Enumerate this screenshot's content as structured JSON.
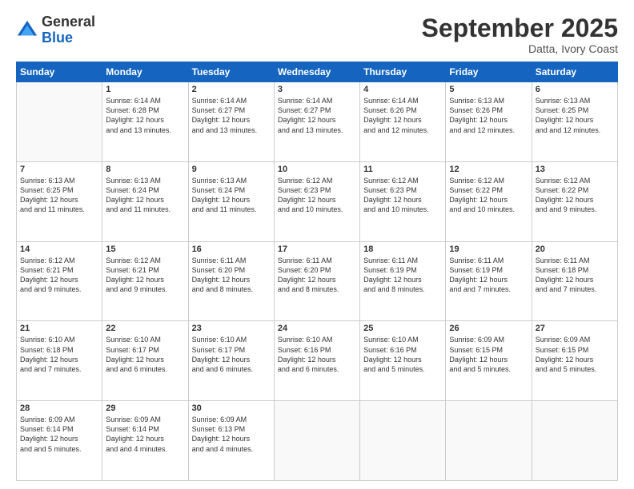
{
  "logo": {
    "general": "General",
    "blue": "Blue"
  },
  "header": {
    "month": "September 2025",
    "location": "Datta, Ivory Coast"
  },
  "weekdays": [
    "Sunday",
    "Monday",
    "Tuesday",
    "Wednesday",
    "Thursday",
    "Friday",
    "Saturday"
  ],
  "weeks": [
    [
      {
        "day": "",
        "sunrise": "",
        "sunset": "",
        "daylight": ""
      },
      {
        "day": "1",
        "sunrise": "Sunrise: 6:14 AM",
        "sunset": "Sunset: 6:28 PM",
        "daylight": "Daylight: 12 hours and 13 minutes."
      },
      {
        "day": "2",
        "sunrise": "Sunrise: 6:14 AM",
        "sunset": "Sunset: 6:27 PM",
        "daylight": "Daylight: 12 hours and 13 minutes."
      },
      {
        "day": "3",
        "sunrise": "Sunrise: 6:14 AM",
        "sunset": "Sunset: 6:27 PM",
        "daylight": "Daylight: 12 hours and 13 minutes."
      },
      {
        "day": "4",
        "sunrise": "Sunrise: 6:14 AM",
        "sunset": "Sunset: 6:26 PM",
        "daylight": "Daylight: 12 hours and 12 minutes."
      },
      {
        "day": "5",
        "sunrise": "Sunrise: 6:13 AM",
        "sunset": "Sunset: 6:26 PM",
        "daylight": "Daylight: 12 hours and 12 minutes."
      },
      {
        "day": "6",
        "sunrise": "Sunrise: 6:13 AM",
        "sunset": "Sunset: 6:25 PM",
        "daylight": "Daylight: 12 hours and 12 minutes."
      }
    ],
    [
      {
        "day": "7",
        "sunrise": "Sunrise: 6:13 AM",
        "sunset": "Sunset: 6:25 PM",
        "daylight": "Daylight: 12 hours and 11 minutes."
      },
      {
        "day": "8",
        "sunrise": "Sunrise: 6:13 AM",
        "sunset": "Sunset: 6:24 PM",
        "daylight": "Daylight: 12 hours and 11 minutes."
      },
      {
        "day": "9",
        "sunrise": "Sunrise: 6:13 AM",
        "sunset": "Sunset: 6:24 PM",
        "daylight": "Daylight: 12 hours and 11 minutes."
      },
      {
        "day": "10",
        "sunrise": "Sunrise: 6:12 AM",
        "sunset": "Sunset: 6:23 PM",
        "daylight": "Daylight: 12 hours and 10 minutes."
      },
      {
        "day": "11",
        "sunrise": "Sunrise: 6:12 AM",
        "sunset": "Sunset: 6:23 PM",
        "daylight": "Daylight: 12 hours and 10 minutes."
      },
      {
        "day": "12",
        "sunrise": "Sunrise: 6:12 AM",
        "sunset": "Sunset: 6:22 PM",
        "daylight": "Daylight: 12 hours and 10 minutes."
      },
      {
        "day": "13",
        "sunrise": "Sunrise: 6:12 AM",
        "sunset": "Sunset: 6:22 PM",
        "daylight": "Daylight: 12 hours and 9 minutes."
      }
    ],
    [
      {
        "day": "14",
        "sunrise": "Sunrise: 6:12 AM",
        "sunset": "Sunset: 6:21 PM",
        "daylight": "Daylight: 12 hours and 9 minutes."
      },
      {
        "day": "15",
        "sunrise": "Sunrise: 6:12 AM",
        "sunset": "Sunset: 6:21 PM",
        "daylight": "Daylight: 12 hours and 9 minutes."
      },
      {
        "day": "16",
        "sunrise": "Sunrise: 6:11 AM",
        "sunset": "Sunset: 6:20 PM",
        "daylight": "Daylight: 12 hours and 8 minutes."
      },
      {
        "day": "17",
        "sunrise": "Sunrise: 6:11 AM",
        "sunset": "Sunset: 6:20 PM",
        "daylight": "Daylight: 12 hours and 8 minutes."
      },
      {
        "day": "18",
        "sunrise": "Sunrise: 6:11 AM",
        "sunset": "Sunset: 6:19 PM",
        "daylight": "Daylight: 12 hours and 8 minutes."
      },
      {
        "day": "19",
        "sunrise": "Sunrise: 6:11 AM",
        "sunset": "Sunset: 6:19 PM",
        "daylight": "Daylight: 12 hours and 7 minutes."
      },
      {
        "day": "20",
        "sunrise": "Sunrise: 6:11 AM",
        "sunset": "Sunset: 6:18 PM",
        "daylight": "Daylight: 12 hours and 7 minutes."
      }
    ],
    [
      {
        "day": "21",
        "sunrise": "Sunrise: 6:10 AM",
        "sunset": "Sunset: 6:18 PM",
        "daylight": "Daylight: 12 hours and 7 minutes."
      },
      {
        "day": "22",
        "sunrise": "Sunrise: 6:10 AM",
        "sunset": "Sunset: 6:17 PM",
        "daylight": "Daylight: 12 hours and 6 minutes."
      },
      {
        "day": "23",
        "sunrise": "Sunrise: 6:10 AM",
        "sunset": "Sunset: 6:17 PM",
        "daylight": "Daylight: 12 hours and 6 minutes."
      },
      {
        "day": "24",
        "sunrise": "Sunrise: 6:10 AM",
        "sunset": "Sunset: 6:16 PM",
        "daylight": "Daylight: 12 hours and 6 minutes."
      },
      {
        "day": "25",
        "sunrise": "Sunrise: 6:10 AM",
        "sunset": "Sunset: 6:16 PM",
        "daylight": "Daylight: 12 hours and 5 minutes."
      },
      {
        "day": "26",
        "sunrise": "Sunrise: 6:09 AM",
        "sunset": "Sunset: 6:15 PM",
        "daylight": "Daylight: 12 hours and 5 minutes."
      },
      {
        "day": "27",
        "sunrise": "Sunrise: 6:09 AM",
        "sunset": "Sunset: 6:15 PM",
        "daylight": "Daylight: 12 hours and 5 minutes."
      }
    ],
    [
      {
        "day": "28",
        "sunrise": "Sunrise: 6:09 AM",
        "sunset": "Sunset: 6:14 PM",
        "daylight": "Daylight: 12 hours and 5 minutes."
      },
      {
        "day": "29",
        "sunrise": "Sunrise: 6:09 AM",
        "sunset": "Sunset: 6:14 PM",
        "daylight": "Daylight: 12 hours and 4 minutes."
      },
      {
        "day": "30",
        "sunrise": "Sunrise: 6:09 AM",
        "sunset": "Sunset: 6:13 PM",
        "daylight": "Daylight: 12 hours and 4 minutes."
      },
      {
        "day": "",
        "sunrise": "",
        "sunset": "",
        "daylight": ""
      },
      {
        "day": "",
        "sunrise": "",
        "sunset": "",
        "daylight": ""
      },
      {
        "day": "",
        "sunrise": "",
        "sunset": "",
        "daylight": ""
      },
      {
        "day": "",
        "sunrise": "",
        "sunset": "",
        "daylight": ""
      }
    ]
  ]
}
